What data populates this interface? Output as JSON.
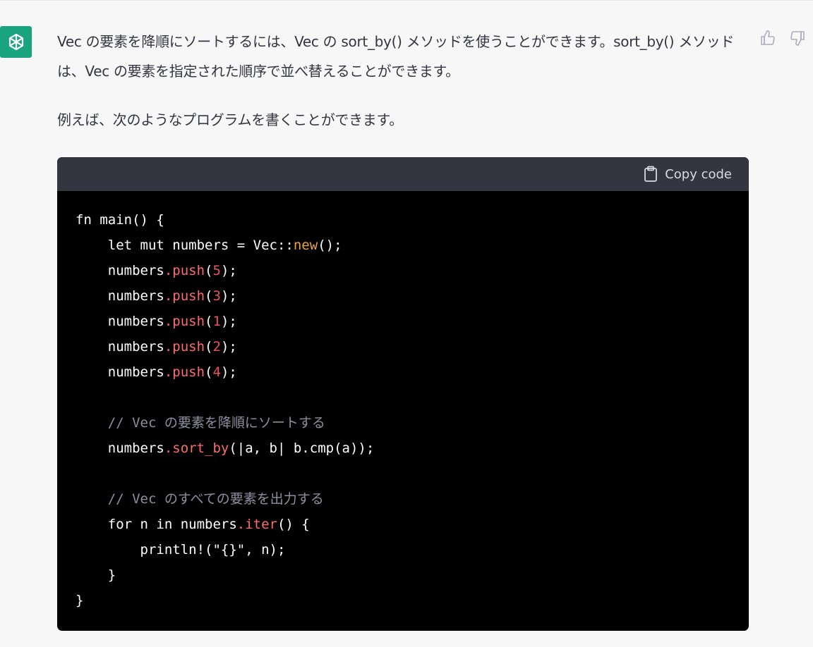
{
  "message": {
    "paragraph1": "Vec の要素を降順にソートするには、Vec の sort_by() メソッドを使うことができます。sort_by() メソッドは、Vec の要素を指定された順序で並べ替えることができます。",
    "paragraph2": "例えば、次のようなプログラムを書くことができます。"
  },
  "code": {
    "copy_label": "Copy code",
    "lines": {
      "l1": "fn main() {",
      "l2_a": "    let mut numbers = Vec::",
      "l2_b": "new",
      "l2_c": "();",
      "l3_a": "    numbers",
      "l3_b": ".push",
      "l3_c": "(",
      "l3_d": "5",
      "l3_e": ");",
      "l4_a": "    numbers",
      "l4_b": ".push",
      "l4_c": "(",
      "l4_d": "3",
      "l4_e": ");",
      "l5_a": "    numbers",
      "l5_b": ".push",
      "l5_c": "(",
      "l5_d": "1",
      "l5_e": ");",
      "l6_a": "    numbers",
      "l6_b": ".push",
      "l6_c": "(",
      "l6_d": "2",
      "l6_e": ");",
      "l7_a": "    numbers",
      "l7_b": ".push",
      "l7_c": "(",
      "l7_d": "4",
      "l7_e": ");",
      "l9": "    // Vec の要素を降順にソートする",
      "l10_a": "    numbers",
      "l10_b": ".sort_by",
      "l10_c": "(|a, b| b.cmp(a));",
      "l12": "    // Vec のすべての要素を出力する",
      "l13_a": "    for n in numbers",
      "l13_b": ".iter",
      "l13_c": "() {",
      "l14": "        println!(\"{}\", n);",
      "l15": "    }",
      "l16": "}"
    }
  },
  "icons": {
    "avatar": "openai-logo-icon",
    "copy": "clipboard-icon",
    "thumbs_up": "thumbs-up-icon",
    "thumbs_down": "thumbs-down-icon"
  },
  "colors": {
    "avatar_bg": "#19a37f",
    "code_header_bg": "#343541",
    "code_bg": "#000000"
  }
}
